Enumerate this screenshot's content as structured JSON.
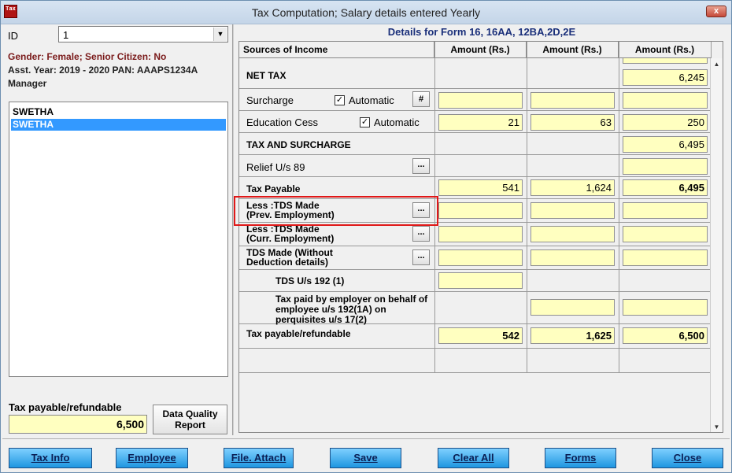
{
  "window": {
    "title": "Tax Computation;  Salary details entered Yearly",
    "close_label": "x",
    "icon_text": "Tax"
  },
  "left": {
    "id_label": "ID",
    "id_value": "1",
    "gender_line": "Gender: Female;  Senior Citizen: No",
    "year_line": "Asst. Year: 2019 - 2020  PAN: AAAPS1234A",
    "role_line": "Manager",
    "names": [
      "SWETHA",
      "SWETHA"
    ],
    "tax_label": "Tax payable/refundable",
    "tax_value": "6,500",
    "dq_button": "Data Quality Report"
  },
  "grid": {
    "title": "Details for Form 16, 16AA, 12BA,2D,2E",
    "headers": [
      "Sources of Income",
      "Amount (Rs.)",
      "Amount (Rs.)",
      "Amount (Rs.)"
    ],
    "net_tax": {
      "label": "NET TAX",
      "c3": "6,245"
    },
    "surcharge": {
      "label": "Surcharge",
      "auto": "Automatic",
      "hash": "#",
      "c1": "",
      "c2": "",
      "c3": ""
    },
    "edu_cess": {
      "label": "Education Cess",
      "auto": "Automatic",
      "c1": "21",
      "c2": "63",
      "c3": "250"
    },
    "tax_sur": {
      "label": "TAX AND SURCHARGE",
      "c3": "6,495"
    },
    "relief": {
      "label": "Relief U/s 89",
      "dots": "...",
      "c3": ""
    },
    "tax_payable": {
      "label": "Tax Payable",
      "c1": "541",
      "c2": "1,624",
      "c3": "6,495"
    },
    "tds_prev": {
      "label1": "Less :TDS Made",
      "label2": "(Prev. Employment)",
      "dots": "..."
    },
    "tds_curr": {
      "label1": "Less :TDS Made",
      "label2": "(Curr. Employment)",
      "dots": "..."
    },
    "tds_wo": {
      "label1": "TDS Made (Without",
      "label2": "Deduction details)",
      "dots": "..."
    },
    "tds_192": {
      "label": "TDS U/s 192 (1)"
    },
    "tax_employer": {
      "label1": "Tax paid by employer on behalf of",
      "label2": "employee u/s 192(1A) on",
      "label3": "perquisites u/s 17(2)"
    },
    "refundable": {
      "label": "Tax payable/refundable",
      "c1": "542",
      "c2": "1,625",
      "c3": "6,500"
    }
  },
  "buttons": [
    "Tax Info",
    "Employee",
    "File. Attach",
    "Save",
    "Clear All",
    "Forms",
    "Close"
  ],
  "colors": {
    "accent_blue": "#1f96e0",
    "yellow_cell": "#ffffc0",
    "highlight_red": "#e01818"
  }
}
